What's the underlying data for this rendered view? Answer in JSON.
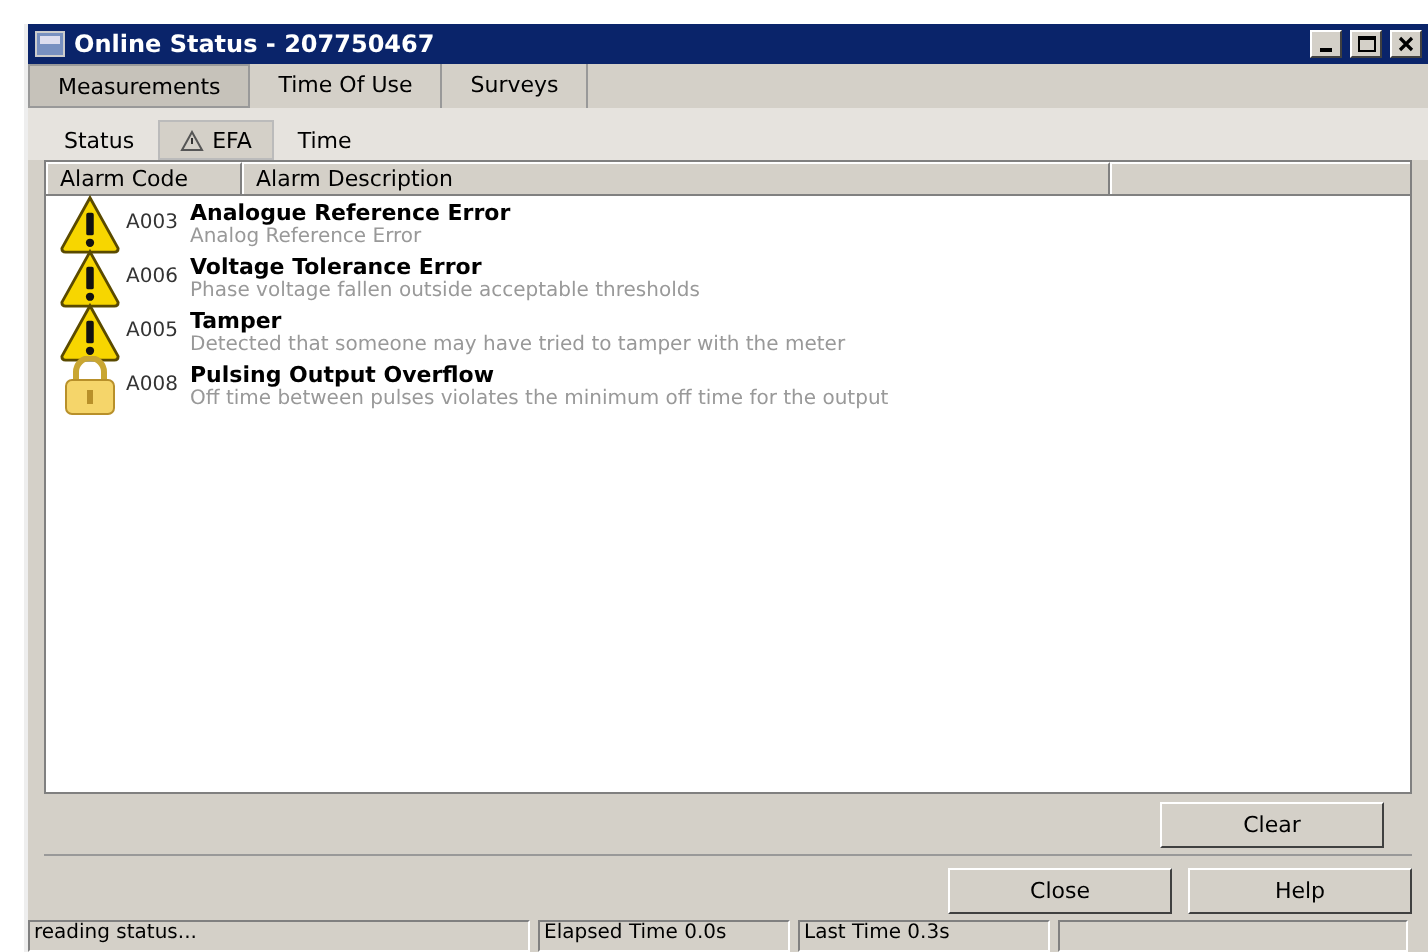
{
  "window": {
    "title": "Online Status - 207750467"
  },
  "tabs": [
    {
      "label": "Measurements",
      "selected": true
    },
    {
      "label": "Time Of Use",
      "selected": false
    },
    {
      "label": "Surveys",
      "selected": false
    }
  ],
  "subtabs": [
    {
      "label": "Status",
      "selected": false,
      "icon": false
    },
    {
      "label": "EFA",
      "selected": true,
      "icon": true
    },
    {
      "label": "Time",
      "selected": false,
      "icon": false
    }
  ],
  "table": {
    "columns": [
      "Alarm Code",
      "Alarm Description"
    ],
    "rows": [
      {
        "kind": "warning",
        "code": "A003",
        "title": "Analogue Reference Error",
        "description": "Analog Reference Error"
      },
      {
        "kind": "warning",
        "code": "A006",
        "title": "Voltage Tolerance Error",
        "description": "Phase voltage fallen outside acceptable thresholds"
      },
      {
        "kind": "warning",
        "code": "A005",
        "title": "Tamper",
        "description": "Detected that someone may have tried to tamper with the meter"
      },
      {
        "kind": "lock",
        "code": "A008",
        "title": "Pulsing Output Overflow",
        "description": "Off time between pulses violates the minimum off time for the output"
      }
    ]
  },
  "clear_button": "Clear",
  "buttons": [
    "Close",
    "Help"
  ],
  "status_bar": [
    "reading status...",
    "Elapsed Time 0.0s",
    "Last Time 0.3s"
  ]
}
